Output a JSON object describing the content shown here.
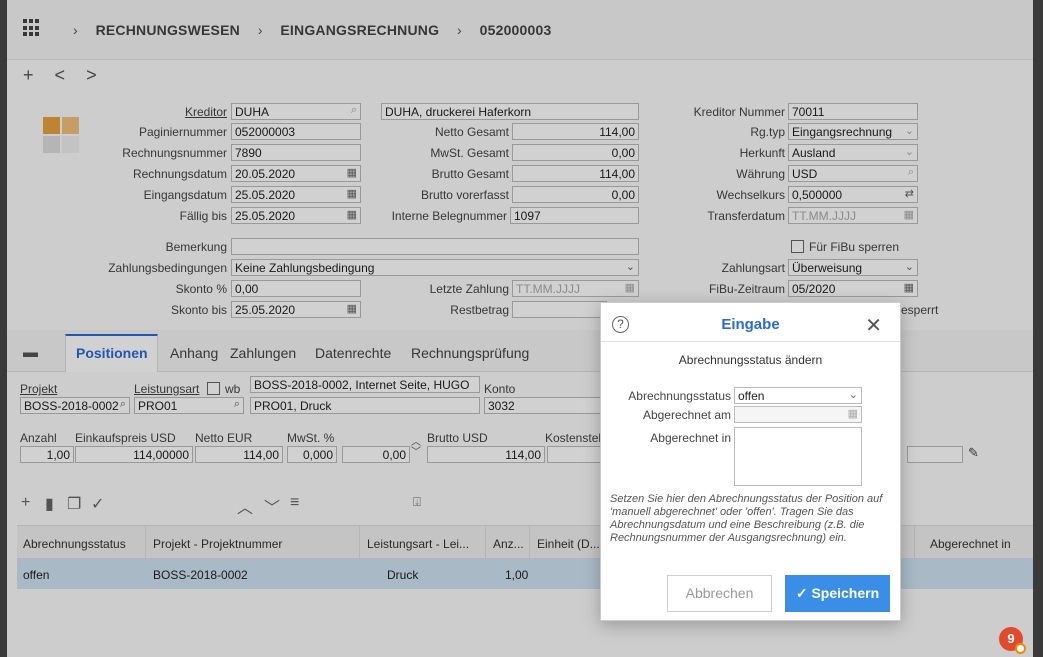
{
  "breadcrumb": [
    "RECHNUNGSWESEN",
    "EINGANGSRECHNUNG",
    "052000003"
  ],
  "nav": {
    "add": "+",
    "prev": "<",
    "next": ">"
  },
  "form": {
    "kreditor_label": "Kreditor",
    "kreditor": "DUHA",
    "kreditor_name": "DUHA, druckerei Haferkorn",
    "paginiernummer_label": "Paginiernummer",
    "paginiernummer": "052000003",
    "rechnungsnummer_label": "Rechnungsnummer",
    "rechnungsnummer": "7890",
    "rechnungsdatum_label": "Rechnungsdatum",
    "rechnungsdatum": "20.05.2020",
    "eingangsdatum_label": "Eingangsdatum",
    "eingangsdatum": "25.05.2020",
    "faellig_label": "Fällig bis",
    "faellig": "25.05.2020",
    "netto_label": "Netto Gesamt",
    "netto": "114,00",
    "mwst_label": "MwSt. Gesamt",
    "mwst": "0,00",
    "brutto_label": "Brutto Gesamt",
    "brutto": "114,00",
    "brutto_vorerfasst_label": "Brutto vorerfasst",
    "brutto_vorerfasst": "0,00",
    "interne_label": "Interne Belegnummer",
    "interne": "1097",
    "kreditor_nummer_label": "Kreditor Nummer",
    "kreditor_nummer": "70011",
    "rgtyp_label": "Rg.typ",
    "rgtyp": "Eingangsrechnung",
    "herkunft_label": "Herkunft",
    "herkunft": "Ausland",
    "waehrung_label": "Währung",
    "waehrung": "USD",
    "wechselkurs_label": "Wechselkurs",
    "wechselkurs": "0,500000",
    "transferdatum_label": "Transferdatum",
    "transferdatum_placeholder": "TT.MM.JJJJ",
    "bemerkung_label": "Bemerkung",
    "bemerkung": "",
    "zahlungsbed_label": "Zahlungsbedingungen",
    "zahlungsbed": "Keine Zahlungsbedingung",
    "skonto_pct_label": "Skonto %",
    "skonto_pct": "0,00",
    "skonto_bis_label": "Skonto bis",
    "skonto_bis": "25.05.2020",
    "letzte_zahlung_label": "Letzte Zahlung",
    "letzte_zahlung_placeholder": "TT.MM.JJJJ",
    "restbetrag_label": "Restbetrag",
    "fibu_sperren_label": "Für FiBu sperren",
    "zahlungsart_label": "Zahlungsart",
    "zahlungsart": "Überweisung",
    "fibu_zeitraum_label": "FiBu-Zeitraum",
    "fibu_zeitraum": "05/2020",
    "gesperrt_partial": "esperrt"
  },
  "tabs": [
    "Positionen",
    "Anhang",
    "Zahlungen",
    "Datenrechte",
    "Rechnungsprüfung"
  ],
  "position": {
    "projekt_label": "Projekt",
    "projekt": "BOSS-2018-0002",
    "leistungsart_label": "Leistungsart",
    "wb_label": "wb",
    "leistungsart": "PRO01",
    "leistungsart_name": "PRO01, Druck",
    "projekt_name": "BOSS-2018-0002, Internet Seite, HUGO",
    "konto_label": "Konto",
    "konto": "3032",
    "anzahl_label": "Anzahl",
    "anzahl": "1,00",
    "einkaufspreis_label": "Einkaufspreis USD",
    "einkaufspreis": "114,00000",
    "netto_eur_label": "Netto EUR",
    "netto_eur": "114,00",
    "mwst_pct_label": "MwSt. %",
    "mwst_pct": "0,000",
    "mwst_val": "0,00",
    "brutto_usd_label": "Brutto USD",
    "brutto_usd": "114,00",
    "kostenstelle_label": "Kostenstel"
  },
  "table": {
    "headers": [
      "Abrechnungsstatus",
      "Projekt - Projektnummer",
      "Leistungsart - Lei...",
      "Anz...",
      "Einheit (D...",
      "Abgerechnet in"
    ],
    "rows": [
      {
        "status": "offen",
        "projekt": "BOSS-2018-0002",
        "leistungsart": "Druck",
        "anzahl": "1,00"
      }
    ]
  },
  "dialog": {
    "title": "Eingabe",
    "subtitle": "Abrechnungsstatus ändern",
    "status_label": "Abrechnungsstatus",
    "status_value": "offen",
    "abgerechnet_am_label": "Abgerechnet am",
    "abgerechnet_in_label": "Abgerechnet in",
    "description": "Setzen Sie hier den Abrechnungsstatus der Position auf 'manuell abgerechnet' oder 'offen'. Tragen Sie das Abrechnungsdatum und eine Beschreibung (z.B. die Rechnungsnummer der Ausgangsrechnung) ein.",
    "cancel": "Abbrechen",
    "save": "Speichern"
  },
  "notification_count": "9"
}
